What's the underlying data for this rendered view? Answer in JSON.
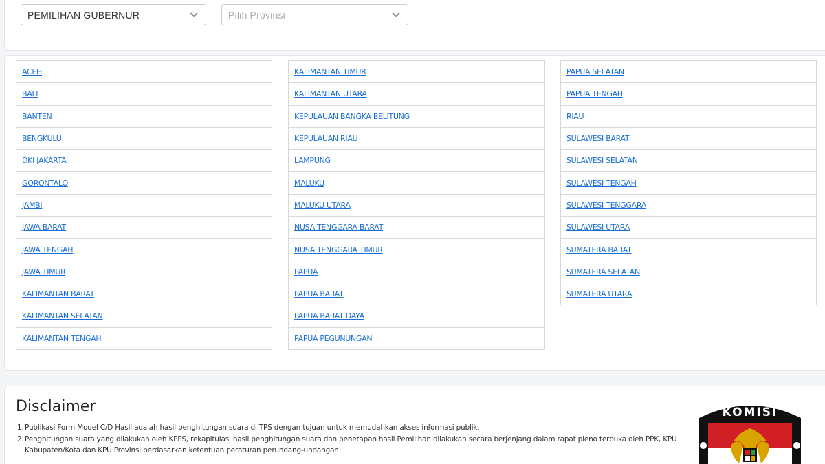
{
  "filters": {
    "election_type": "PEMILIHAN GUBERNUR",
    "province_placeholder": "Pilih Provinsi"
  },
  "provinces": {
    "column1": [
      "ACEH",
      "BALI",
      "BANTEN",
      "BENGKULU",
      "DKI JAKARTA",
      "GORONTALO",
      "JAMBI",
      "JAWA BARAT",
      "JAWA TENGAH",
      "JAWA TIMUR",
      "KALIMANTAN BARAT",
      "KALIMANTAN SELATAN",
      "KALIMANTAN TENGAH"
    ],
    "column2": [
      "KALIMANTAN TIMUR",
      "KALIMANTAN UTARA",
      "KEPULAUAN BANGKA BELITUNG",
      "KEPULAUAN RIAU",
      "LAMPUNG",
      "MALUKU",
      "MALUKU UTARA",
      "NUSA TENGGARA BARAT",
      "NUSA TENGGARA TIMUR",
      "PAPUA",
      "PAPUA BARAT",
      "PAPUA BARAT DAYA",
      "PAPUA PEGUNUNGAN"
    ],
    "column3": [
      "PAPUA SELATAN",
      "PAPUA TENGAH",
      "RIAU",
      "SULAWESI BARAT",
      "SULAWESI SELATAN",
      "SULAWESI TENGAH",
      "SULAWESI TENGGARA",
      "SULAWESI UTARA",
      "SUMATERA BARAT",
      "SUMATERA SELATAN",
      "SUMATERA UTARA"
    ]
  },
  "disclaimer": {
    "title": "Disclaimer",
    "items": [
      {
        "num": "1.",
        "text": "Publikasi Form Model C/D Hasil adalah hasil penghitungan suara di TPS dengan tujuan untuk memudahkan akses informasi publik."
      },
      {
        "num": "2.",
        "text": "Penghitungan suara yang dilakukan oleh KPPS, rekapitulasi hasil penghitungan suara dan penetapan hasil Pemilihan dilakukan secara berjenjang dalam rapat pleno terbuka oleh PPK, KPU Kabupaten/Kota dan KPU Provinsi berdasarkan ketentuan peraturan perundang-undangan."
      }
    ]
  },
  "logo": {
    "text": "KOMISI",
    "icon": "kpu-logo-icon"
  },
  "colors": {
    "link": "#1a6fd6",
    "logo_red": "#d21f26",
    "logo_black": "#111111",
    "logo_gold": "#d9a400"
  }
}
